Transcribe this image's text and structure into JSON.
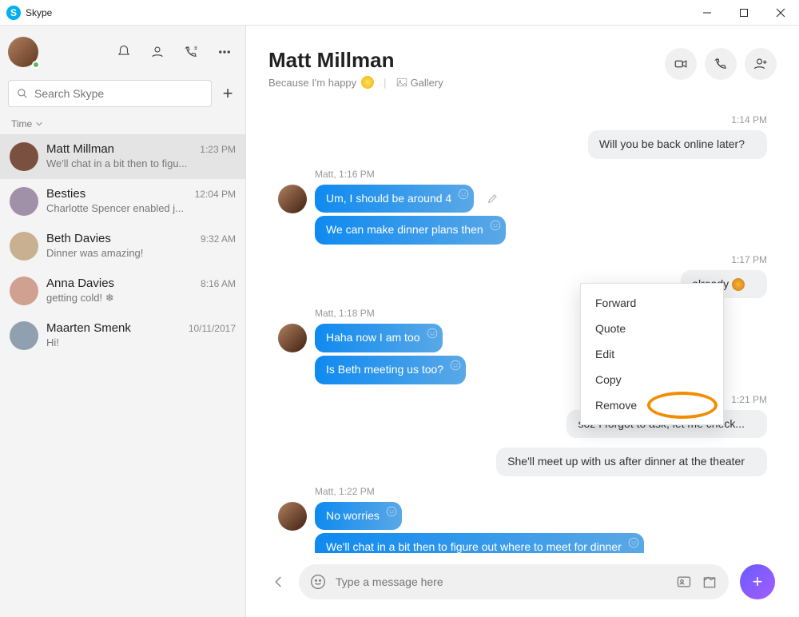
{
  "window": {
    "title": "Skype"
  },
  "sidebar": {
    "search_placeholder": "Search Skype",
    "sort_label": "Time",
    "items": [
      {
        "name": "Matt Millman",
        "preview": "We'll chat in a bit then to figu...",
        "time": "1:23 PM",
        "color": "#7a5040"
      },
      {
        "name": "Besties",
        "preview": "Charlotte Spencer enabled j...",
        "time": "12:04 PM",
        "color": "#a090a8"
      },
      {
        "name": "Beth Davies",
        "preview": "Dinner was amazing!",
        "time": "9:32 AM",
        "color": "#c8b090"
      },
      {
        "name": "Anna Davies",
        "preview": "getting cold! ❄",
        "time": "8:16 AM",
        "color": "#d0a090"
      },
      {
        "name": "Maarten Smenk",
        "preview": "Hi!",
        "time": "10/11/2017",
        "color": "#90a0b0"
      }
    ]
  },
  "chat": {
    "title": "Matt Millman",
    "status": "Because I'm happy",
    "gallery_label": "Gallery"
  },
  "messages": {
    "sep1": "1:14 PM",
    "out1": "Will you be back online later?",
    "meta1": "Matt, 1:16 PM",
    "in1a": "Um, I should be around 4",
    "in1b": "We can make dinner plans then",
    "sep2": "1:17 PM",
    "out2": "already",
    "meta2": "Matt, 1:18 PM",
    "in2a": "Haha now I am too",
    "in2b": "Is Beth meeting us too?",
    "sep3": "1:21 PM",
    "out3a": "soz I forgot to ask, let me check...",
    "out3b": "She'll meet up with us after dinner at the theater",
    "meta3": "Matt, 1:22 PM",
    "in3a": "No worries",
    "in3b": "We'll chat in a bit then to figure out where to meet for dinner"
  },
  "context_menu": {
    "forward": "Forward",
    "quote": "Quote",
    "edit": "Edit",
    "copy": "Copy",
    "remove": "Remove"
  },
  "composer": {
    "placeholder": "Type a message here"
  }
}
